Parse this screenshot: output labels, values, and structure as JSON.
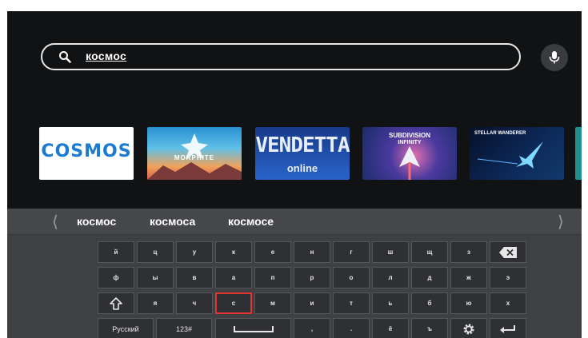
{
  "search": {
    "query": "космос"
  },
  "results": [
    {
      "title": "COSMOS"
    },
    {
      "title": "MORPHITE"
    },
    {
      "title": "VENDETTA",
      "subtitle": "online"
    },
    {
      "title": "SUBDIVISION",
      "subtitle": "INFINITY"
    },
    {
      "title": "STELLAR WANDERER"
    }
  ],
  "suggestions": [
    "космос",
    "космоса",
    "космосе"
  ],
  "keyboard": {
    "row1": [
      "й",
      "ц",
      "у",
      "к",
      "е",
      "н",
      "г",
      "ш",
      "щ",
      "з"
    ],
    "row2": [
      "ф",
      "ы",
      "в",
      "а",
      "п",
      "р",
      "о",
      "л",
      "д",
      "ж",
      "э"
    ],
    "row3": [
      "я",
      "ч",
      "с",
      "м",
      "и",
      "т",
      "ь",
      "б",
      "ю",
      "х"
    ],
    "row4": {
      "lang": "Русский",
      "num": "123#",
      "comma": ",",
      "dot": ".",
      "yo": "ё",
      "hard": "ъ"
    }
  },
  "colors": {
    "selected": "#e0342f",
    "background": "#111214",
    "keyboard": "#3f4044"
  }
}
